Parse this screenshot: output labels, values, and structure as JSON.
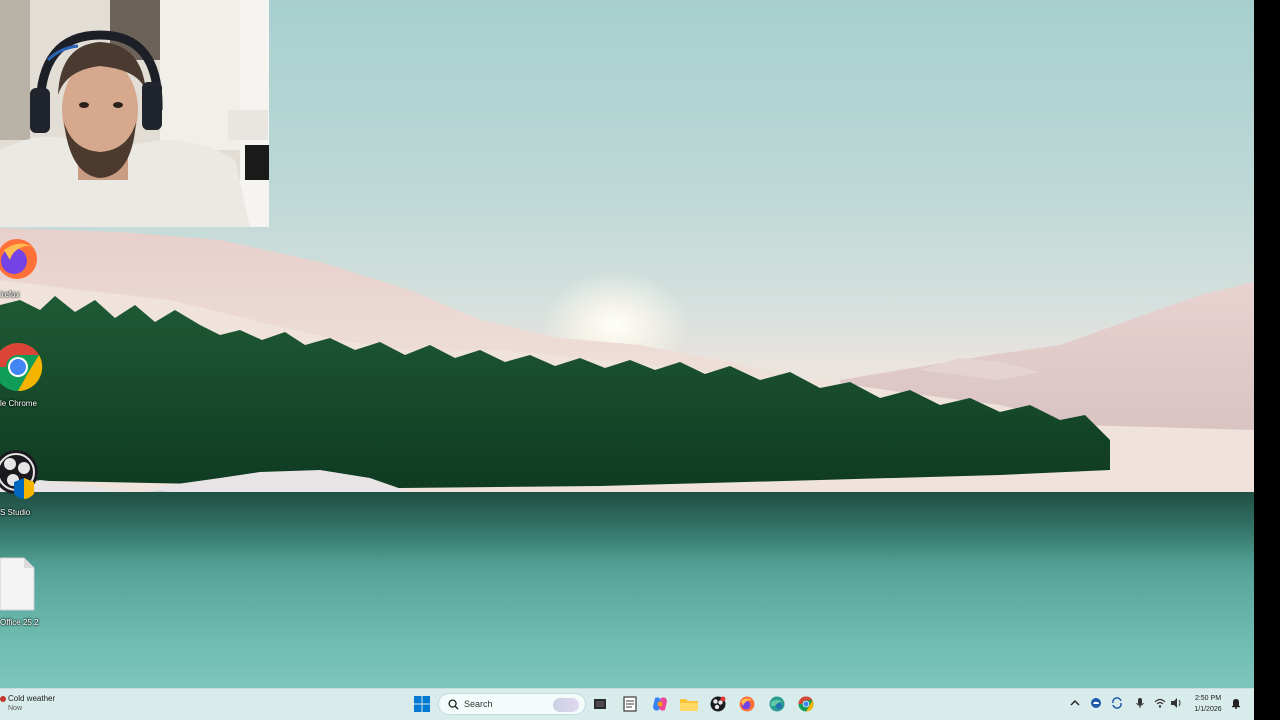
{
  "desktop": {
    "icons": [
      {
        "name": "firefox",
        "label": "Firefox"
      },
      {
        "name": "chrome",
        "label": "Google Chrome"
      },
      {
        "name": "obs-studio",
        "label": "OBS Studio"
      },
      {
        "name": "office",
        "label": "Office 25.2"
      }
    ],
    "visible_labels": [
      "irefox",
      "le Chrome",
      "S Studio",
      "Office 25.2"
    ]
  },
  "taskbar": {
    "weather": {
      "title": "Cold weather",
      "subtitle": "Now"
    },
    "search": {
      "placeholder": "Search"
    },
    "pinned_apps": [
      "start-icon",
      "search",
      "task-view-icon",
      "notepad-icon",
      "copilot-icon",
      "file-explorer-icon",
      "obs-icon",
      "firefox-icon",
      "edge-dev-icon",
      "chrome-icon"
    ],
    "clock": {
      "time": "2:50 PM",
      "date": "1/1/2026"
    }
  },
  "colors": {
    "taskbar_bg": "#d9ecec",
    "accent_blue": "#0067c0",
    "firefox_orange": "#ff7139",
    "chrome_red": "#db4437",
    "chrome_yellow": "#f4b400",
    "chrome_green": "#0f9d58"
  }
}
